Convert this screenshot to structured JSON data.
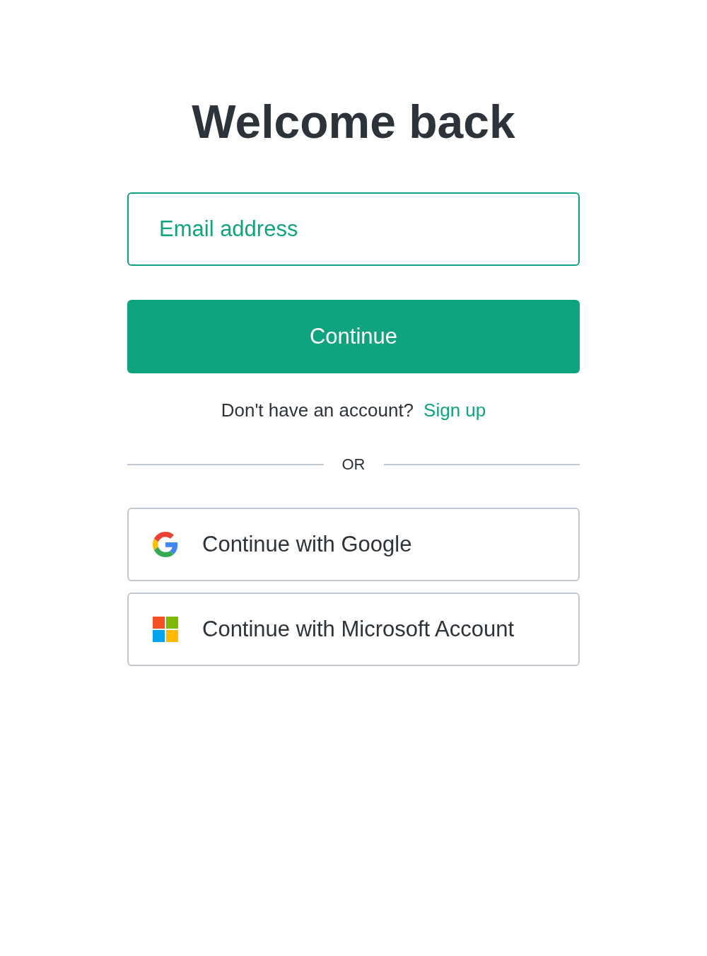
{
  "heading": "Welcome back",
  "email_field": {
    "placeholder": "Email address",
    "focused": true
  },
  "continue_button": "Continue",
  "signup_prompt": {
    "text": "Don't have an account?",
    "link": "Sign up"
  },
  "divider": "OR",
  "providers": [
    {
      "kind": "google",
      "label": "Continue with Google"
    },
    {
      "kind": "microsoft",
      "label": "Continue with Microsoft Account"
    }
  ]
}
